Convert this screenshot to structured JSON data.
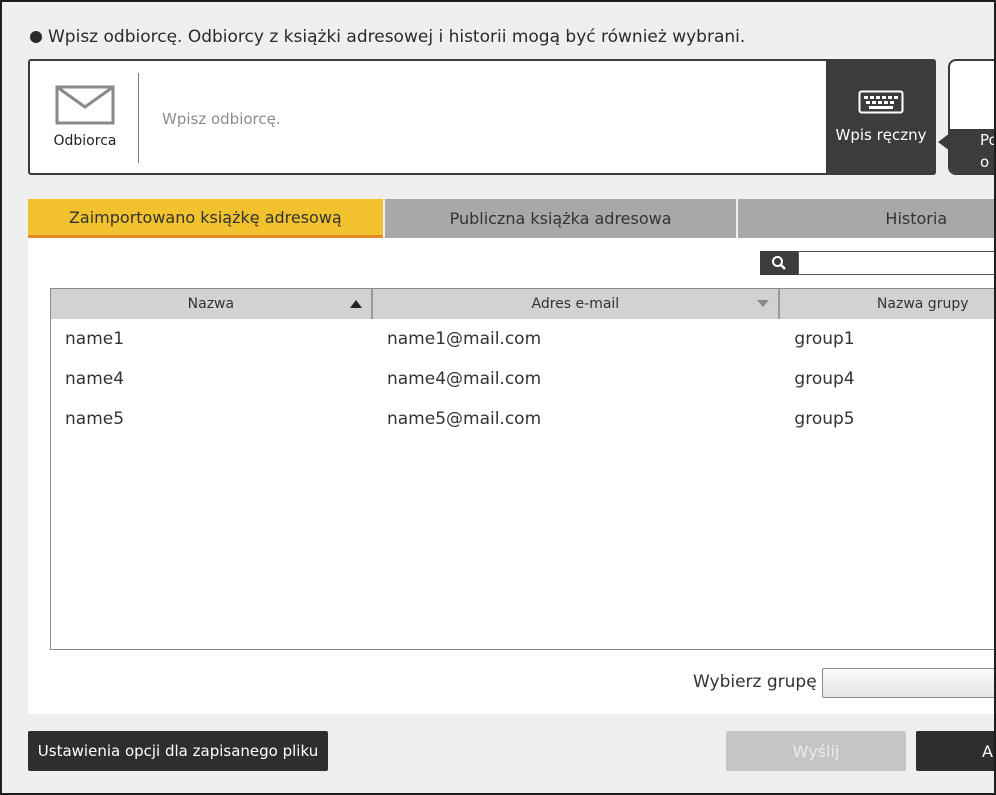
{
  "instruction": "Wpisz odbiorcę. Odbiorcy z książki adresowej i historii mogą być również wybrani.",
  "recipient": {
    "icon_label": "Odbiorca",
    "placeholder": "Wpisz odbiorcę.",
    "manual_button": "Wpis ręczny",
    "side_button_partial": "Po\no"
  },
  "tabs": [
    {
      "label": "Zaimportowano książkę adresową",
      "active": true
    },
    {
      "label": "Publiczna książka adresowa",
      "active": false
    },
    {
      "label": "Historia",
      "active": false
    }
  ],
  "search": {
    "placeholder": ""
  },
  "table": {
    "headers": [
      "Nazwa",
      "Adres e-mail",
      "Nazwa grupy"
    ],
    "rows": [
      [
        "name1",
        "name1@mail.com",
        "group1"
      ],
      [
        "name4",
        "name4@mail.com",
        "group4"
      ],
      [
        "name5",
        "name5@mail.com",
        "group5"
      ]
    ]
  },
  "group_select": {
    "label": "Wybierz grupę",
    "value": ""
  },
  "buttons": {
    "settings": "Ustawienia opcji dla zapisanego pliku",
    "send": "Wyślij",
    "cancel_partial": "An"
  },
  "colors": {
    "active_tab": "#f2c12e",
    "active_tab_underline": "#e8871e",
    "inactive_tab": "#a8a8a8",
    "dark_button": "#2e2e2e",
    "disabled_button": "#c6c6c6"
  }
}
